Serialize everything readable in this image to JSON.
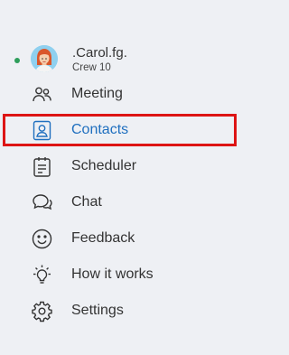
{
  "profile": {
    "name": ".Carol.fg.",
    "subtitle": "Crew 10",
    "status_color": "#2e9e5b",
    "avatar_icon": "avatar-woman-red-hair"
  },
  "nav": {
    "items": [
      {
        "label": "Meeting",
        "icon": "people-icon"
      },
      {
        "label": "Contacts",
        "icon": "contact-card-icon",
        "active": true
      },
      {
        "label": "Scheduler",
        "icon": "clipboard-icon"
      },
      {
        "label": "Chat",
        "icon": "chat-bubbles-icon"
      },
      {
        "label": "Feedback",
        "icon": "smiley-icon"
      },
      {
        "label": "How it works",
        "icon": "lightbulb-icon"
      },
      {
        "label": "Settings",
        "icon": "gear-icon"
      }
    ]
  },
  "colors": {
    "background": "#eef0f4",
    "active_text": "#1f6fbf",
    "highlight_border": "#dd1414",
    "text": "#333333"
  }
}
